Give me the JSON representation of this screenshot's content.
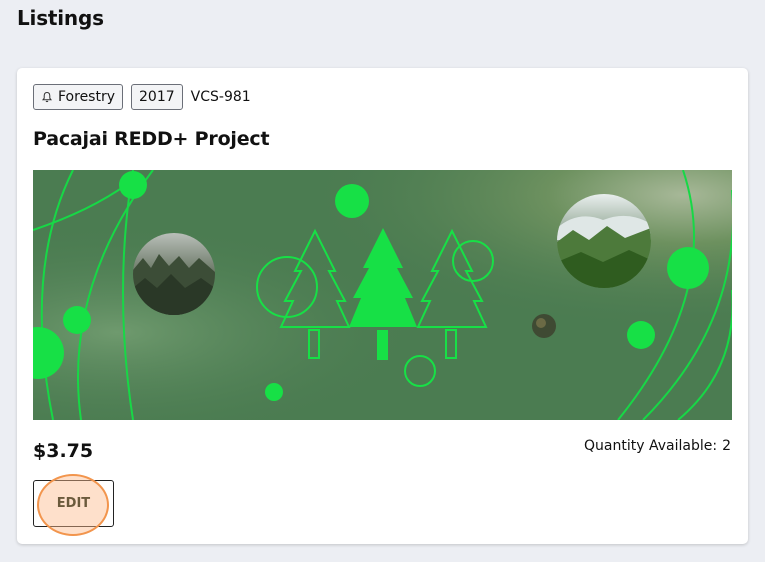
{
  "page": {
    "title": "Listings"
  },
  "listing": {
    "category": "Forestry",
    "category_icon": "bell-icon",
    "vintage": "2017",
    "registry_id": "VCS-981",
    "title": "Pacajai REDD+ Project",
    "price": "$3.75",
    "quantity_label": "Quantity Available:",
    "quantity_value": "2",
    "edit_label": "EDIT"
  },
  "colors": {
    "banner_bg": "#4d7d52",
    "accent_green": "#16e046",
    "highlight": "#f2954d"
  }
}
